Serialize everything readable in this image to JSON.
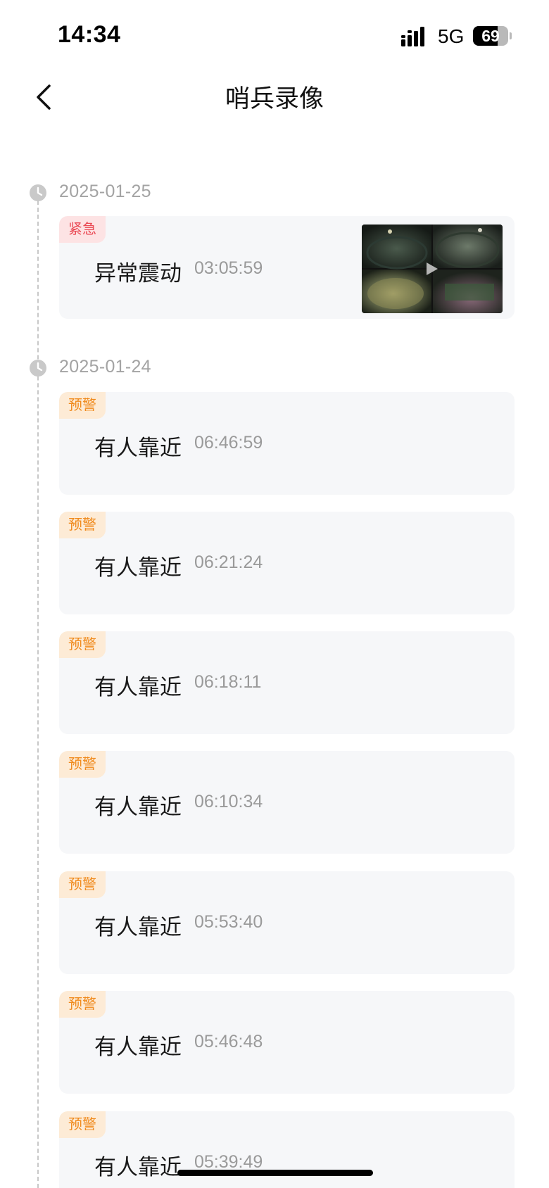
{
  "status_bar": {
    "time": "14:34",
    "network": "5G",
    "battery_level": "69",
    "signal_icon": "signal-bars-icon"
  },
  "nav": {
    "title": "哨兵录像",
    "back_icon": "chevron-left-icon"
  },
  "colors": {
    "urgent_text": "#ea4a55",
    "urgent_bg": "#fde3e4",
    "warn_text": "#f08a1c",
    "warn_bg": "#fdebd6",
    "card_bg": "#f6f7f9",
    "muted_text": "#9a9a9a"
  },
  "groups": [
    {
      "date": "2025-01-25",
      "events": [
        {
          "tag": "紧急",
          "name": "异常震动",
          "time": "03:05:59",
          "has_thumbnail": true
        }
      ]
    },
    {
      "date": "2025-01-24",
      "events": [
        {
          "tag": "预警",
          "name": "有人靠近",
          "time": "06:46:59"
        },
        {
          "tag": "预警",
          "name": "有人靠近",
          "time": "06:21:24"
        },
        {
          "tag": "预警",
          "name": "有人靠近",
          "time": "06:18:11"
        },
        {
          "tag": "预警",
          "name": "有人靠近",
          "time": "06:10:34"
        },
        {
          "tag": "预警",
          "name": "有人靠近",
          "time": "05:53:40"
        },
        {
          "tag": "预警",
          "name": "有人靠近",
          "time": "05:46:48"
        },
        {
          "tag": "预警",
          "name": "有人靠近",
          "time": "05:39:49"
        }
      ]
    }
  ]
}
